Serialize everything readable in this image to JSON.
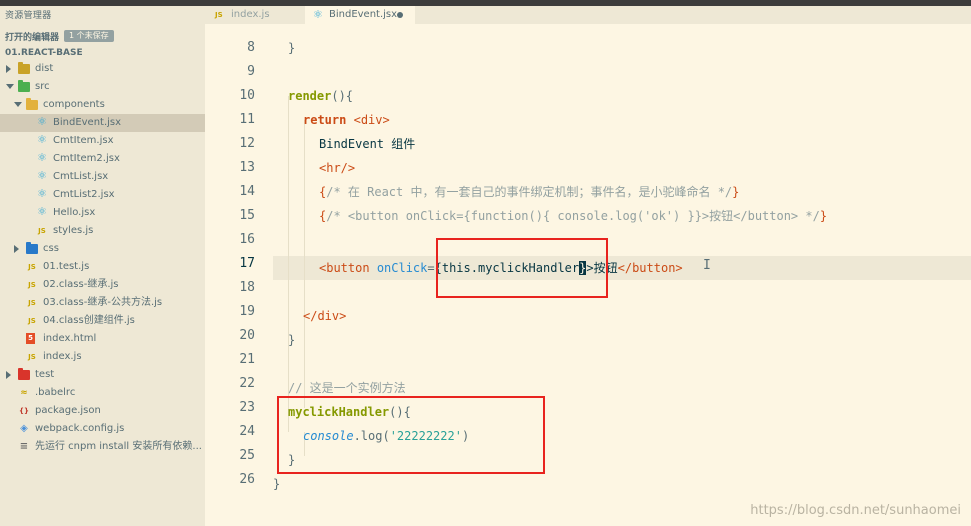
{
  "explorer": {
    "title": "资源管理器",
    "open_editors_label": "打开的编辑器",
    "unsaved_badge": "1 个未保存",
    "project_name": "01.REACT-BASE",
    "tree": [
      {
        "name": "dist",
        "icon": "folder-dist-icon",
        "depth": 0,
        "state": "closed"
      },
      {
        "name": "src",
        "icon": "folder-src-icon",
        "depth": 0,
        "state": "open"
      },
      {
        "name": "components",
        "icon": "folder-components-icon",
        "depth": 1,
        "state": "open"
      },
      {
        "name": "BindEvent.jsx",
        "icon": "react-file-icon",
        "depth": 2,
        "selected": true
      },
      {
        "name": "CmtItem.jsx",
        "icon": "react-file-icon",
        "depth": 2
      },
      {
        "name": "CmtItem2.jsx",
        "icon": "react-file-icon",
        "depth": 2
      },
      {
        "name": "CmtList.jsx",
        "icon": "react-file-icon",
        "depth": 2
      },
      {
        "name": "CmtList2.jsx",
        "icon": "react-file-icon",
        "depth": 2
      },
      {
        "name": "Hello.jsx",
        "icon": "react-file-icon",
        "depth": 2
      },
      {
        "name": "styles.js",
        "icon": "js-file-icon",
        "depth": 2
      },
      {
        "name": "css",
        "icon": "folder-css-icon",
        "depth": 1,
        "state": "closed"
      },
      {
        "name": "01.test.js",
        "icon": "js-test-file-icon",
        "depth": 1
      },
      {
        "name": "02.class-继承.js",
        "icon": "js-file-icon",
        "depth": 1
      },
      {
        "name": "03.class-继承-公共方法.js",
        "icon": "js-file-icon",
        "depth": 1
      },
      {
        "name": "04.class创建组件.js",
        "icon": "js-file-icon",
        "depth": 1
      },
      {
        "name": "index.html",
        "icon": "html-file-icon",
        "depth": 1
      },
      {
        "name": "index.js",
        "icon": "js-file-icon",
        "depth": 1
      },
      {
        "name": "test",
        "icon": "folder-test-icon",
        "depth": 0,
        "state": "closed"
      },
      {
        "name": ".babelrc",
        "icon": "babel-file-icon",
        "depth": 0
      },
      {
        "name": "package.json",
        "icon": "json-file-icon",
        "depth": 0
      },
      {
        "name": "webpack.config.js",
        "icon": "webpack-file-icon",
        "depth": 0
      },
      {
        "name": "先运行 cnpm install 安装所有依赖...",
        "icon": "text-file-icon",
        "depth": 0
      }
    ]
  },
  "tabs": [
    {
      "label": "index.js",
      "icon": "JS",
      "active": false
    },
    {
      "label": "BindEvent.jsx",
      "icon": "⚛",
      "active": true,
      "dirty": true
    }
  ],
  "editor": {
    "line_numbers": [
      "8",
      "9",
      "10",
      "11",
      "12",
      "13",
      "14",
      "15",
      "16",
      "17",
      "18",
      "19",
      "20",
      "21",
      "22",
      "23",
      "24",
      "25",
      "26"
    ],
    "cursor_line": "17",
    "code": {
      "l8": "}",
      "l10_fn": "render",
      "l10_rest": "(){",
      "l11_kw": "return",
      "l11_tag": "<div>",
      "l12_text": "BindEvent 组件",
      "l13_tag": "<hr/>",
      "l14_open": "{",
      "l14_comment": "/* 在 React 中，有一套自己的事件绑定机制；事件名，是小驼峰命名 */",
      "l14_close": "}",
      "l15_open": "{",
      "l15_comment": "/* <button onClick={function(){ console.log('ok') }}>按钮</button> */",
      "l15_close": "}",
      "l17_tag_open": "<button",
      "l17_attr": "onClick",
      "l17_eq": "=",
      "l17_brace_open": "{",
      "l17_expr": "this.myclickHandler",
      "l17_brace_close": "}",
      "l17_gt": ">",
      "l17_text": "按钮",
      "l17_tag_close": "</button>",
      "l19_tag": "</div>",
      "l20": "}",
      "l22_comment": "// 这是一个实例方法",
      "l23_fn": "myclickHandler",
      "l23_rest": "(){",
      "l24_obj": "console",
      "l24_mid": ".log(",
      "l24_str": "'22222222'",
      "l24_end": ")",
      "l25": "}",
      "l26": "}"
    }
  },
  "watermark": "https://blog.csdn.net/sunhaomei",
  "colors": {
    "background": "#fdf6e3",
    "sidebar": "#eee8d5",
    "keyword": "#859900",
    "tag": "#cb4b16",
    "attribute": "#268bd2",
    "string": "#2aa198",
    "comment": "#93a1a1",
    "annotation_box": "#e8231e"
  }
}
